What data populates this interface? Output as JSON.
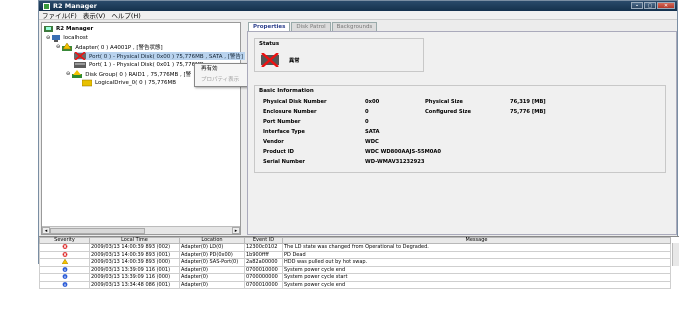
{
  "window": {
    "title": "R2 Manager",
    "controls": [
      "–",
      "▢",
      "✕"
    ]
  },
  "menu": [
    "ファイル(F)",
    "表示(V)",
    "ヘルプ(H)"
  ],
  "tree": {
    "root": "R2 Manager",
    "host": "localhost",
    "adapter": "Adapter( 0 ) A4001P , [警告状態]",
    "port0": "Port( 0 ) - Physical Disk( 0x00 ) 75,776MB , SATA , [警告]",
    "port1": "Port( 1 ) - Physical Disk( 0x01 ) 75,776MB",
    "diskgroup": "Disk Group( 0 ) RAID1 , 75,776MB , [警",
    "logical": "LogicalDrive_0( 0 ) 75,776MB"
  },
  "context_menu": {
    "enable": "再有効",
    "properties": "プロパティ表示"
  },
  "tabs": [
    "Properties",
    "Disk Patrol",
    "Backgrounds"
  ],
  "status": {
    "title": "Status",
    "value": "異常"
  },
  "basic_info": {
    "title": "Basic Information",
    "rows": [
      {
        "label": "Physical Disk Number",
        "value": "0x00"
      },
      {
        "label": "Enclosure Number",
        "value": "0"
      },
      {
        "label": "Port Number",
        "value": "0"
      },
      {
        "label": "Interface Type",
        "value": "SATA"
      },
      {
        "label": "Vendor",
        "value": "WDC"
      },
      {
        "label": "Product ID",
        "value": "WDC WD800AAJS-55M0A0"
      },
      {
        "label": "Serial Number",
        "value": "WD-WMAV31232923"
      }
    ],
    "right": [
      {
        "label": "Physical Size",
        "value": "76,319 [MB]"
      },
      {
        "label": "Configured Size",
        "value": "75,776 [MB]"
      }
    ]
  },
  "log": {
    "headers": [
      "Severity",
      "Local Time",
      "Location",
      "Event ID",
      "Message"
    ],
    "rows": [
      {
        "sev": "error",
        "time": "2009/03/13 14:00:39 893 (002)",
        "loc": "Adapter(0) LD(0)",
        "id": "12300c0102",
        "msg": "The LD state was changed from Operational to Degraded."
      },
      {
        "sev": "error",
        "time": "2009/03/13 14:00:39 893 (001)",
        "loc": "Adapter(0) PD(0x00)",
        "id": "1b900ffff",
        "msg": "PD Dead"
      },
      {
        "sev": "warn",
        "time": "2009/03/13 14:00:39 893 (000)",
        "loc": "Adapter(0) SAS-Port(0)",
        "id": "2a82a00000",
        "msg": "HDD was pulled out by hot swap."
      },
      {
        "sev": "info",
        "time": "2009/03/13 13:39:09 116 (001)",
        "loc": "Adapter(0)",
        "id": "0700010000",
        "msg": "System power cycle end"
      },
      {
        "sev": "info",
        "time": "2009/03/13 13:39:09 116 (000)",
        "loc": "Adapter(0)",
        "id": "0700000000",
        "msg": "System power cycle start"
      },
      {
        "sev": "info",
        "time": "2009/03/13 13:34:48 086 (001)",
        "loc": "Adapter(0)",
        "id": "0700010000",
        "msg": "System power cycle end"
      }
    ]
  }
}
